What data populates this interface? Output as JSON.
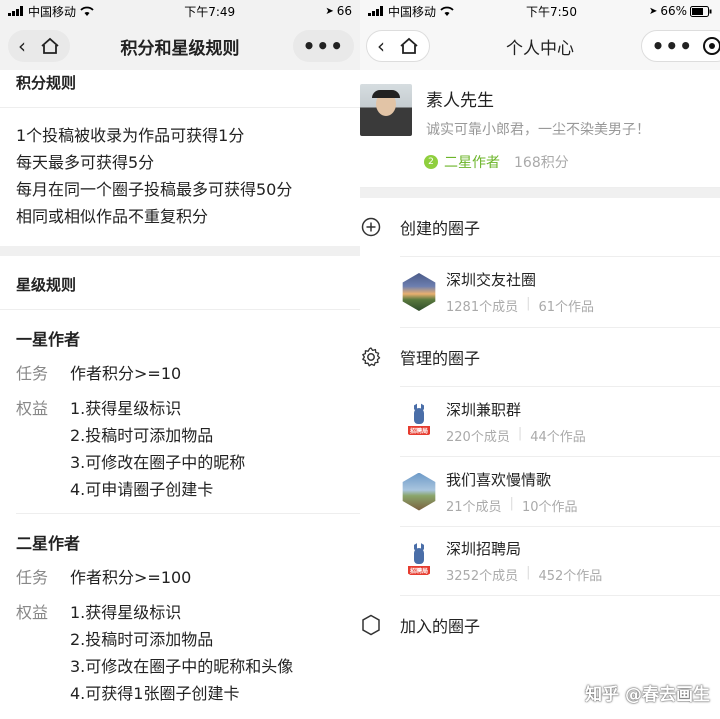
{
  "left": {
    "status": {
      "carrier": "中国移动",
      "time": "下午7:49",
      "battery": "66"
    },
    "nav": {
      "title": "积分和星级规则"
    },
    "points_rules": {
      "heading": "积分规则",
      "lines": [
        "1个投稿被收录为作品可获得1分",
        "每天最多可获得5分",
        "每月在同一个圈子投稿最多可获得50分",
        "相同或相似作品不重复积分"
      ]
    },
    "star_rules": {
      "heading": "星级规则",
      "one_star": {
        "title": "一星作者",
        "task_label": "任务",
        "task": "作者积分>=10",
        "benefit_label": "权益",
        "benefits": [
          "1.获得星级标识",
          "2.投稿时可添加物品",
          "3.可修改在圈子中的昵称",
          "4.可申请圈子创建卡"
        ]
      },
      "two_star": {
        "title": "二星作者",
        "task_label": "任务",
        "task": "作者积分>=100",
        "benefit_label": "权益",
        "benefits": [
          "1.获得星级标识",
          "2.投稿时可添加物品",
          "3.可修改在圈子中的昵称和头像",
          "4.可获得1张圈子创建卡"
        ]
      }
    }
  },
  "right": {
    "status": {
      "carrier": "中国移动",
      "time": "下午7:50",
      "battery": "66%"
    },
    "nav": {
      "title": "个人中心"
    },
    "profile": {
      "name": "素人先生",
      "motto": "诚实可靠小郎君，一尘不染美男子！",
      "level_badge": "2",
      "level": "二星作者",
      "points": "168积分"
    },
    "created": {
      "heading": "创建的圈子",
      "items": [
        {
          "name": "深圳交友社圈",
          "members": "1281个成员",
          "works": "61个作品"
        }
      ]
    },
    "managed": {
      "heading": "管理的圈子",
      "logo_tag": "招聘局",
      "items": [
        {
          "name": "深圳兼职群",
          "members": "220个成员",
          "works": "44个作品"
        },
        {
          "name": "我们喜欢慢情歌",
          "members": "21个成员",
          "works": "10个作品"
        },
        {
          "name": "深圳招聘局",
          "members": "3252个成员",
          "works": "452个作品"
        }
      ]
    },
    "joined": {
      "heading": "加入的圈子"
    },
    "watermark": "知乎 @春去画生"
  },
  "colors": {
    "level_green": "#6cb52a",
    "badge_green": "#8fcf3e",
    "muted": "#999999"
  }
}
